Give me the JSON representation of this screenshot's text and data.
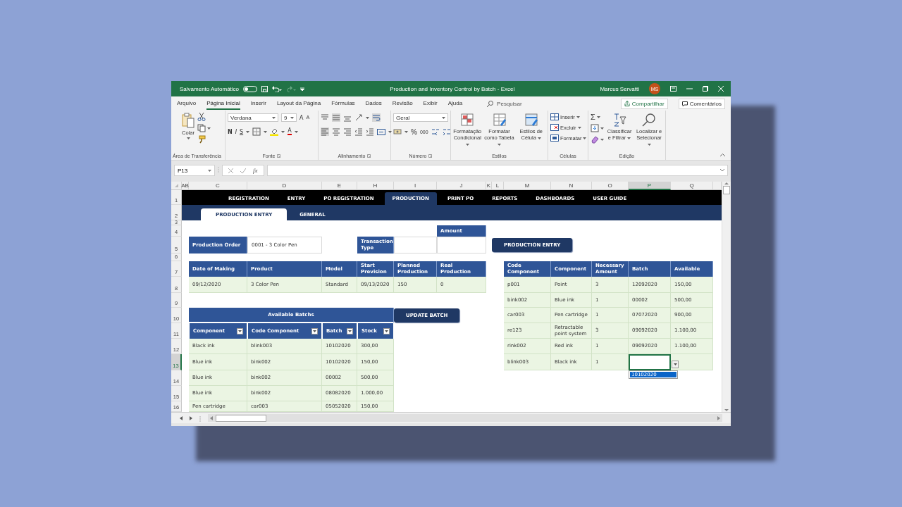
{
  "window": {
    "autosave_label": "Salvamento Automático",
    "autosave_on": false,
    "title": "Production and Inventory Control by Batch  -  Excel",
    "user_name": "Marcus Servatti",
    "user_initials": "MS"
  },
  "ribbon_tabs": [
    {
      "label": "Arquivo",
      "selected": false
    },
    {
      "label": "Página Inicial",
      "selected": true
    },
    {
      "label": "Inserir",
      "selected": false
    },
    {
      "label": "Layout da Página",
      "selected": false
    },
    {
      "label": "Fórmulas",
      "selected": false
    },
    {
      "label": "Dados",
      "selected": false
    },
    {
      "label": "Revisão",
      "selected": false
    },
    {
      "label": "Exibir",
      "selected": false
    },
    {
      "label": "Ajuda",
      "selected": false
    }
  ],
  "search": {
    "placeholder": "Pesquisar"
  },
  "share_button": "Compartilhar",
  "comments_button": "Comentários",
  "ribbon": {
    "clipboard": {
      "paste": "Colar",
      "label": "Área de Transferência"
    },
    "font": {
      "family": "Verdana",
      "size": "9",
      "grow": "A",
      "shrink": "A",
      "bold": "N",
      "italic": "I",
      "underline": "S",
      "color_letter": "A",
      "label": "Fonte"
    },
    "alignment": {
      "label": "Alinhamento"
    },
    "number": {
      "format": "Geral",
      "percent": "%",
      "thousands": "000",
      "label": "Número"
    },
    "styles": {
      "buttons": [
        "Formatação Condicional",
        "Formatar como Tabela",
        "Estilos de Célula"
      ],
      "label": "Estilos"
    },
    "cells": {
      "buttons": [
        "Inserir",
        "Excluir",
        "Formatar"
      ],
      "label": "Células"
    },
    "editing": {
      "sum": "Σ",
      "buttons": [
        "Classificar e Filtrar",
        "Localizar e Selecionar"
      ],
      "label": "Edição"
    }
  },
  "formula_bar": {
    "name_box": "P13",
    "fx": "fx"
  },
  "column_headers": [
    {
      "label": "AB",
      "selected": false
    },
    {
      "label": "C",
      "selected": false
    },
    {
      "label": "D",
      "selected": false
    },
    {
      "label": "E",
      "selected": false
    },
    {
      "label": "H",
      "selected": false
    },
    {
      "label": "I",
      "selected": false
    },
    {
      "label": "J",
      "selected": false
    },
    {
      "label": "K",
      "selected": false
    },
    {
      "label": "L",
      "selected": false
    },
    {
      "label": "M",
      "selected": false
    },
    {
      "label": "N",
      "selected": false
    },
    {
      "label": "O",
      "selected": false
    },
    {
      "label": "P",
      "selected": true
    },
    {
      "label": "Q",
      "selected": false
    }
  ],
  "row_headers": [
    {
      "label": "1",
      "selected": false
    },
    {
      "label": "2",
      "selected": false
    },
    {
      "label": "3",
      "selected": false
    },
    {
      "label": "4",
      "selected": false
    },
    {
      "label": "5",
      "selected": false
    },
    {
      "label": "6",
      "selected": false
    },
    {
      "label": "7",
      "selected": false
    },
    {
      "label": "8",
      "selected": false
    },
    {
      "label": "9",
      "selected": false
    },
    {
      "label": "10",
      "selected": false
    },
    {
      "label": "11",
      "selected": false
    },
    {
      "label": "12",
      "selected": false
    },
    {
      "label": "13",
      "selected": true
    },
    {
      "label": "14",
      "selected": false
    },
    {
      "label": "15",
      "selected": false
    },
    {
      "label": "16",
      "selected": false
    }
  ],
  "nav_tabs": [
    {
      "label": "REGISTRATION",
      "selected": false
    },
    {
      "label": "ENTRY",
      "selected": false
    },
    {
      "label": "PO REGISTRATION",
      "selected": false
    },
    {
      "label": "PRODUCTION",
      "selected": true
    },
    {
      "label": "PRINT PO",
      "selected": false
    },
    {
      "label": "REPORTS",
      "selected": false
    },
    {
      "label": "DASHBOARDS",
      "selected": false
    },
    {
      "label": "USER GUIDE",
      "selected": false
    }
  ],
  "sub_tabs": [
    {
      "label": "PRODUCTION ENTRY",
      "selected": true
    },
    {
      "label": "GENERAL",
      "selected": false
    }
  ],
  "production_order": {
    "label": "Production Order",
    "value": "0001 - 3 Color Pen"
  },
  "transaction_type": {
    "label": "Transaction Type"
  },
  "amount": {
    "label": "Amount"
  },
  "production_entry_button": "PRODUCTION ENTRY",
  "order_table": {
    "columns": [
      "Date of Making",
      "Product",
      "Model",
      "Start Prevision",
      "Planned Production",
      "Real Production"
    ],
    "rows": [
      [
        "09/12/2020",
        "3 Color Pen",
        "Standard",
        "09/13/2020",
        "150",
        "0"
      ]
    ]
  },
  "components_table": {
    "columns": [
      "Code Component",
      "Component",
      "Necessary Amount",
      "Batch",
      "Available"
    ],
    "rows": [
      {
        "cells": [
          "p001",
          "Point",
          "3",
          "12092020",
          "150,00"
        ],
        "selected": false
      },
      {
        "cells": [
          "bink002",
          "Blue ink",
          "1",
          "00002",
          "500,00"
        ],
        "selected": false
      },
      {
        "cells": [
          "car003",
          "Pen cartridge",
          "1",
          "07072020",
          "900,00"
        ],
        "selected": false
      },
      {
        "cells": [
          "re123",
          "Retractable point system",
          "3",
          "09092020",
          "1.100,00"
        ],
        "selected": false
      },
      {
        "cells": [
          "rink002",
          "Red ink",
          "1",
          "09092020",
          "1.100,00"
        ],
        "selected": false
      },
      {
        "cells": [
          "blink003",
          "Black ink",
          "1"
        ],
        "selected": true
      }
    ],
    "dropdown": {
      "options": [
        {
          "label": "10102020",
          "selected": true
        }
      ]
    }
  },
  "available_batches": {
    "title": "Available Batchs",
    "columns": [
      "Component",
      "Code Component",
      "Batch",
      "Stock"
    ],
    "rows": [
      [
        "Black ink",
        "blink003",
        "10102020",
        "300,00"
      ],
      [
        "Blue ink",
        "bink002",
        "10102020",
        "150,00"
      ],
      [
        "Blue ink",
        "bink002",
        "00002",
        "500,00"
      ],
      [
        "Blue ink",
        "bink002",
        "08082020",
        "1.000,00"
      ],
      [
        "Pen cartridge",
        "car003",
        "05052020",
        "150,00"
      ]
    ]
  },
  "update_batch_button": "UPDATE BATCH"
}
